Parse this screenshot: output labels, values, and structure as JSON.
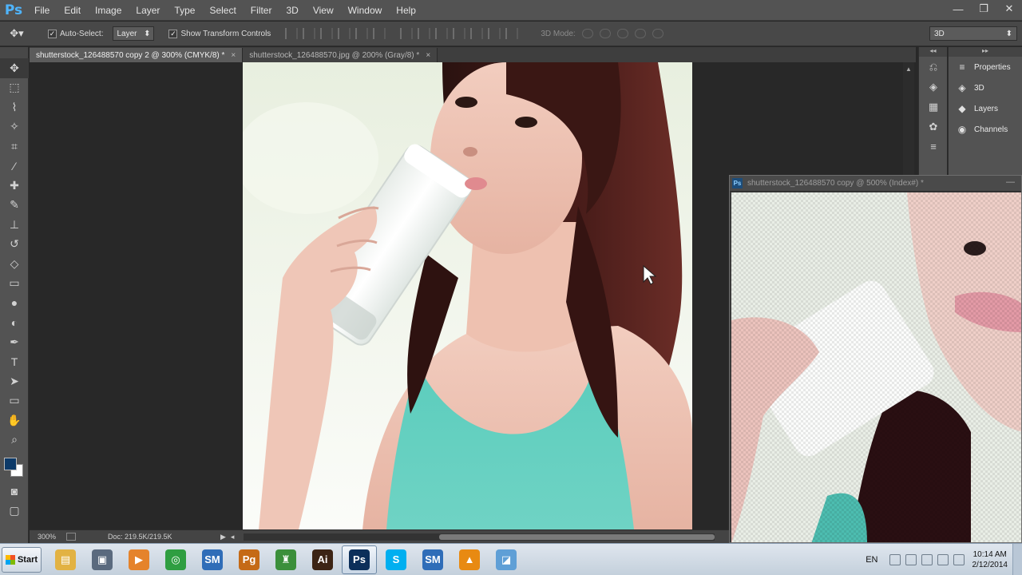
{
  "app": {
    "logo": "Ps",
    "menu": [
      "File",
      "Edit",
      "Image",
      "Layer",
      "Type",
      "Select",
      "Filter",
      "3D",
      "View",
      "Window",
      "Help"
    ],
    "window_controls": {
      "minimize": "—",
      "restore": "❐",
      "close": "✕"
    }
  },
  "options_bar": {
    "tool_glyph": "✥▾",
    "auto_select_label": "Auto-Select:",
    "auto_select_checked": true,
    "auto_select_target": "Layer",
    "show_transform_label": "Show Transform Controls",
    "show_transform_checked": true,
    "mode_3d_label": "3D Mode:",
    "workspace": "3D"
  },
  "tools": [
    {
      "name": "move-tool",
      "glyph": "✥",
      "active": true
    },
    {
      "name": "marquee-tool",
      "glyph": "⬚",
      "active": false
    },
    {
      "name": "lasso-tool",
      "glyph": "⌇",
      "active": false
    },
    {
      "name": "quick-select-tool",
      "glyph": "✧",
      "active": false
    },
    {
      "name": "crop-tool",
      "glyph": "⌗",
      "active": false
    },
    {
      "name": "eyedropper-tool",
      "glyph": "⁄",
      "active": false
    },
    {
      "name": "healing-brush-tool",
      "glyph": "✚",
      "active": false
    },
    {
      "name": "brush-tool",
      "glyph": "✎",
      "active": false
    },
    {
      "name": "clone-stamp-tool",
      "glyph": "⊥",
      "active": false
    },
    {
      "name": "history-brush-tool",
      "glyph": "↺",
      "active": false
    },
    {
      "name": "eraser-tool",
      "glyph": "◇",
      "active": false
    },
    {
      "name": "gradient-tool",
      "glyph": "▭",
      "active": false
    },
    {
      "name": "blur-tool",
      "glyph": "●",
      "active": false
    },
    {
      "name": "dodge-tool",
      "glyph": "◐",
      "active": false
    },
    {
      "name": "pen-tool",
      "glyph": "✒",
      "active": false
    },
    {
      "name": "type-tool",
      "glyph": "T",
      "active": false
    },
    {
      "name": "path-select-tool",
      "glyph": "➤",
      "active": false
    },
    {
      "name": "rectangle-tool",
      "glyph": "▭",
      "active": false
    },
    {
      "name": "hand-tool",
      "glyph": "✋",
      "active": false
    },
    {
      "name": "zoom-tool",
      "glyph": "⌕",
      "active": false
    }
  ],
  "swatches": {
    "foreground": "#0d3a68",
    "background": "#ffffff"
  },
  "tabs": [
    {
      "label": "shutterstock_126488570 copy 2 @ 300% (CMYK/8) *",
      "close": "×",
      "active": true
    },
    {
      "label": "shutterstock_126488570.jpg @ 200% (Gray/8) *",
      "close": "×",
      "active": false
    }
  ],
  "status": {
    "zoom": "300%",
    "doc_size": "Doc: 219.5K/219.5K",
    "arrow": "▶",
    "scroll_left": "◂"
  },
  "panels": [
    {
      "label": "Properties",
      "icon": "≡"
    },
    {
      "label": "3D",
      "icon": "◈"
    },
    {
      "label": "Layers",
      "icon": "◆"
    },
    {
      "label": "Channels",
      "icon": "◉"
    }
  ],
  "floating_window": {
    "logo": "Ps",
    "title": "shutterstock_126488570 copy @ 500% (Index#) *",
    "minimize": "—"
  },
  "taskbar": {
    "start_label": "Start",
    "apps": [
      {
        "name": "file-explorer",
        "label": "▤",
        "color": "#e2b243"
      },
      {
        "name": "desktop-app",
        "label": "▣",
        "color": "#5a6a7e"
      },
      {
        "name": "media-player",
        "label": "▶",
        "color": "#e5832b"
      },
      {
        "name": "chrome",
        "label": "◎",
        "color": "#2f9e41"
      },
      {
        "name": "app-sm",
        "label": "SM",
        "color": "#2f6db8"
      },
      {
        "name": "adobe-incopy",
        "label": "Pg",
        "color": "#c56a16"
      },
      {
        "name": "app-games",
        "label": "♜",
        "color": "#3b8f3b"
      },
      {
        "name": "adobe-illustrator",
        "label": "Ai",
        "color": "#3c2415"
      },
      {
        "name": "adobe-photoshop",
        "label": "Ps",
        "color": "#0c2f5a"
      },
      {
        "name": "skype",
        "label": "S",
        "color": "#00aff0"
      },
      {
        "name": "app-sm-2",
        "label": "SM",
        "color": "#2f6db8"
      },
      {
        "name": "vlc",
        "label": "▲",
        "color": "#e88a12"
      },
      {
        "name": "app-window",
        "label": "◪",
        "color": "#5f9fd6"
      }
    ],
    "active_app": "adobe-photoshop",
    "language": "EN",
    "time": "10:14 AM",
    "date": "2/12/2014"
  }
}
